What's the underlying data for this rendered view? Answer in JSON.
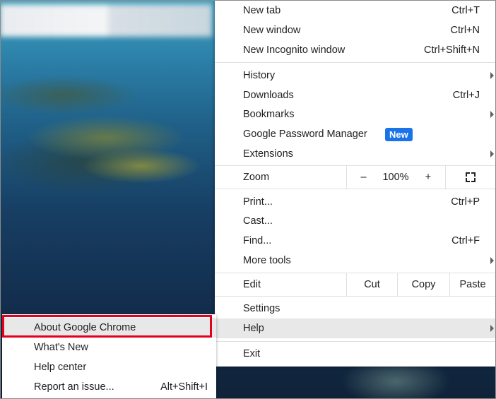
{
  "menu": {
    "new_tab": {
      "label": "New tab",
      "shortcut": "Ctrl+T"
    },
    "new_window": {
      "label": "New window",
      "shortcut": "Ctrl+N"
    },
    "new_incognito": {
      "label": "New Incognito window",
      "shortcut": "Ctrl+Shift+N"
    },
    "history": {
      "label": "History"
    },
    "downloads": {
      "label": "Downloads",
      "shortcut": "Ctrl+J"
    },
    "bookmarks": {
      "label": "Bookmarks"
    },
    "password_manager": {
      "label": "Google Password Manager",
      "badge": "New"
    },
    "extensions": {
      "label": "Extensions"
    },
    "zoom": {
      "label": "Zoom",
      "minus": "–",
      "level": "100%",
      "plus": "+"
    },
    "print": {
      "label": "Print...",
      "shortcut": "Ctrl+P"
    },
    "cast": {
      "label": "Cast..."
    },
    "find": {
      "label": "Find...",
      "shortcut": "Ctrl+F"
    },
    "more_tools": {
      "label": "More tools"
    },
    "edit": {
      "label": "Edit",
      "cut": "Cut",
      "copy": "Copy",
      "paste": "Paste"
    },
    "settings": {
      "label": "Settings"
    },
    "help": {
      "label": "Help"
    },
    "exit": {
      "label": "Exit"
    }
  },
  "help_submenu": {
    "about": {
      "label": "About Google Chrome"
    },
    "whats_new": {
      "label": "What's New"
    },
    "help_center": {
      "label": "Help center"
    },
    "report_issue": {
      "label": "Report an issue...",
      "shortcut": "Alt+Shift+I"
    }
  },
  "colors": {
    "badge_blue": "#1a73e8",
    "highlight": "#e8e8e8",
    "annotation_red": "#e3001b"
  }
}
